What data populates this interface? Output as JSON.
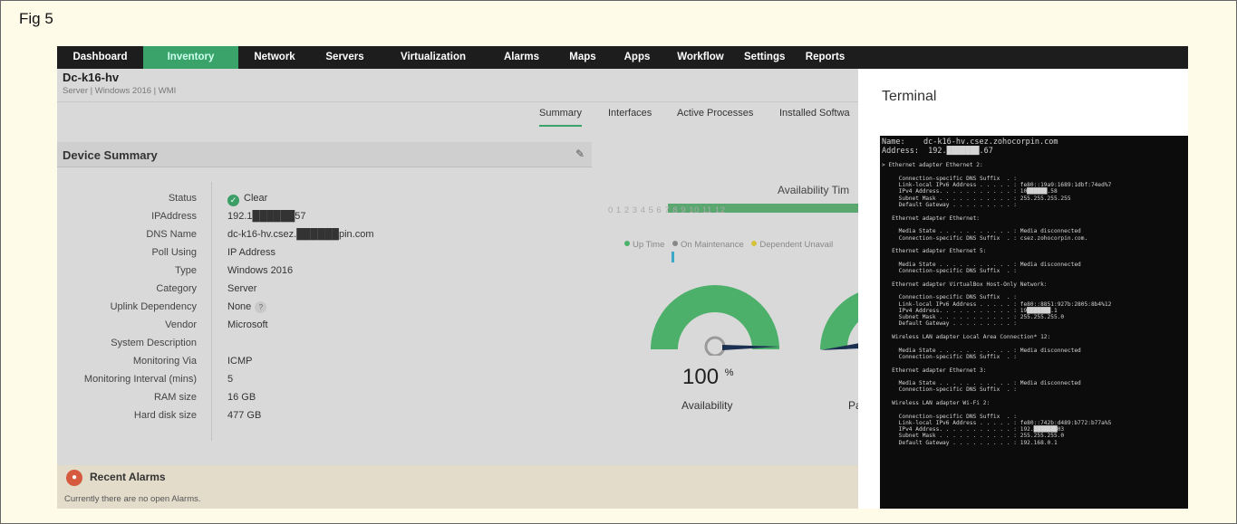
{
  "figure_label": "Fig 5",
  "nav": [
    "Dashboard",
    "Inventory",
    "Network",
    "Servers",
    "Virtualization",
    "Alarms",
    "Maps",
    "Apps",
    "Workflow",
    "Settings",
    "Reports"
  ],
  "device": {
    "name": "Dc-k16-hv",
    "subtitle": "Server | Windows 2016 | WMI"
  },
  "tabs": [
    "Summary",
    "Interfaces",
    "Active Processes",
    "Installed Softwa"
  ],
  "summary": {
    "title": "Device Summary",
    "rows": [
      {
        "key": "Status",
        "value": "Clear"
      },
      {
        "key": "IPAddress",
        "value": "192.1██████57"
      },
      {
        "key": "DNS Name",
        "value": "dc-k16-hv.csez.██████pin.com"
      },
      {
        "key": "Poll Using",
        "value": "IP Address"
      },
      {
        "key": "Type",
        "value": "Windows 2016"
      },
      {
        "key": "Category",
        "value": "Server"
      },
      {
        "key": "Uplink Dependency",
        "value": "None"
      },
      {
        "key": "Vendor",
        "value": "Microsoft"
      },
      {
        "key": "System Description",
        "value": ""
      },
      {
        "key": "Monitoring Via",
        "value": "ICMP"
      },
      {
        "key": "Monitoring Interval (mins)",
        "value": "5"
      },
      {
        "key": "RAM size",
        "value": "16 GB"
      },
      {
        "key": "Hard disk size",
        "value": "477 GB"
      }
    ]
  },
  "availability": {
    "title": "Availability Tim",
    "timeline": "0  1  2  3  4  5  6  7  8  9  10  11  12",
    "legend": [
      "Up Time",
      "On Maintenance",
      "Dependent Unavail"
    ],
    "percent": "100",
    "unit": "%",
    "label": "Availability",
    "second_label": "Pa"
  },
  "alarms": {
    "title": "Recent Alarms",
    "message": "Currently there are no open Alarms."
  },
  "terminal": {
    "title": "Terminal",
    "lines": [
      "Name:    dc-k16-hv.csez.zohocorpin.com",
      "Address:  192.███████.67",
      "",
      "> Ethernet adapter Ethernet 2:",
      "",
      "     Connection-specific DNS Suffix  . :",
      "     Link-local IPv6 Address . . . . . : fe80::19a9:1689:1dbf:74ed%7",
      "     IPv4 Address. . . . . . . . . . . : 10██████.58",
      "     Subnet Mask . . . . . . . . . . . : 255.255.255.255",
      "     Default Gateway . . . . . . . . . :",
      "",
      "   Ethernet adapter Ethernet:",
      "",
      "     Media State . . . . . . . . . . . : Media disconnected",
      "     Connection-specific DNS Suffix  . : csez.zohocorpin.com.",
      "",
      "   Ethernet adapter Ethernet 5:",
      "",
      "     Media State . . . . . . . . . . . : Media disconnected",
      "     Connection-specific DNS Suffix  . :",
      "",
      "   Ethernet adapter VirtualBox Host-Only Network:",
      "",
      "     Connection-specific DNS Suffix  . :",
      "     Link-local IPv6 Address . . . . . : fe80::8851:927b:2805:8b4%12",
      "     IPv4 Address. . . . . . . . . . . : 19███████.1",
      "     Subnet Mask . . . . . . . . . . . : 255.255.255.0",
      "     Default Gateway . . . . . . . . . :",
      "",
      "   Wireless LAN adapter Local Area Connection* 12:",
      "",
      "     Media State . . . . . . . . . . . : Media disconnected",
      "     Connection-specific DNS Suffix  . :",
      "",
      "   Ethernet adapter Ethernet 3:",
      "",
      "     Media State . . . . . . . . . . . : Media disconnected",
      "     Connection-specific DNS Suffix  . :",
      "",
      "   Wireless LAN adapter Wi-Fi 2:",
      "",
      "     Connection-specific DNS Suffix  . :",
      "     Link-local IPv6 Address . . . . . : fe80::742b:d489:b772:b77a%5",
      "     IPv4 Address. . . . . . . . . . . : 192.███████03",
      "     Subnet Mask . . . . . . . . . . . : 255.255.255.0",
      "     Default Gateway . . . . . . . . . : 192.168.0.1"
    ]
  },
  "colors": {
    "nav_bg": "#1d1d1d",
    "accent_green": "#3aa36a",
    "gauge_green": "#4caf6a",
    "gauge_needle": "#1b2f52",
    "alarm_red": "#d55a3e"
  }
}
